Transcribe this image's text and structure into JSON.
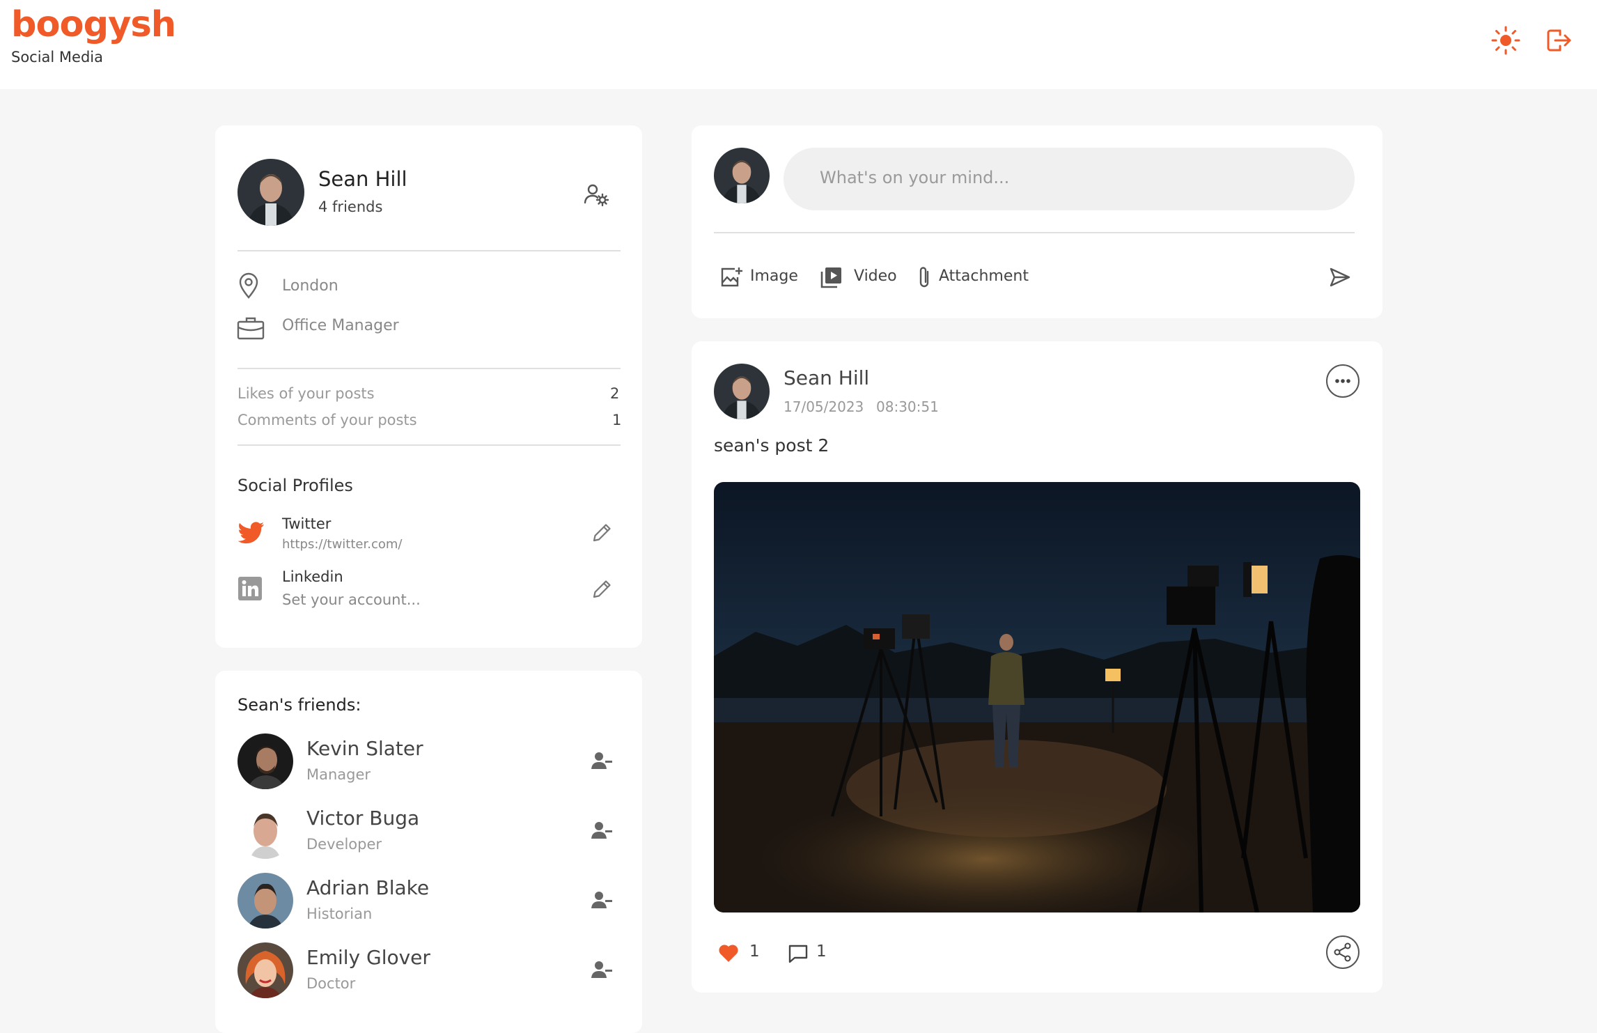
{
  "brand": {
    "name": "boogysh",
    "tagline": "Social Media"
  },
  "colors": {
    "accent": "#f05a28",
    "muted": "#888888",
    "bg": "#f6f6f6"
  },
  "header": {
    "theme_icon": "sun-icon",
    "logout_icon": "logout-icon"
  },
  "profile": {
    "name": "Sean Hill",
    "friends_count": "4 friends",
    "location": "London",
    "occupation": "Office Manager",
    "stats": [
      {
        "label": "Likes of your posts",
        "value": "2"
      },
      {
        "label": "Comments of your posts",
        "value": "1"
      }
    ],
    "social_title": "Social Profiles",
    "social": [
      {
        "name": "Twitter",
        "value": "https://twitter.com/",
        "icon": "twitter-icon"
      },
      {
        "name": "Linkedin",
        "value": "Set your account...",
        "icon": "linkedin-icon"
      }
    ]
  },
  "friends": {
    "title": "Sean's friends:",
    "list": [
      {
        "name": "Kevin Slater",
        "role": "Manager"
      },
      {
        "name": "Victor Buga",
        "role": "Developer"
      },
      {
        "name": "Adrian Blake",
        "role": "Historian"
      },
      {
        "name": "Emily Glover",
        "role": "Doctor"
      }
    ]
  },
  "composer": {
    "placeholder": "What's on your mind...",
    "actions": [
      {
        "label": "Image",
        "icon": "image-add-icon"
      },
      {
        "label": "Video",
        "icon": "video-icon"
      },
      {
        "label": "Attachment",
        "icon": "paperclip-icon"
      }
    ]
  },
  "post": {
    "author": "Sean Hill",
    "date": "17/05/2023",
    "time": "08:30:51",
    "text": "sean's post 2",
    "likes": "1",
    "comments": "1"
  }
}
